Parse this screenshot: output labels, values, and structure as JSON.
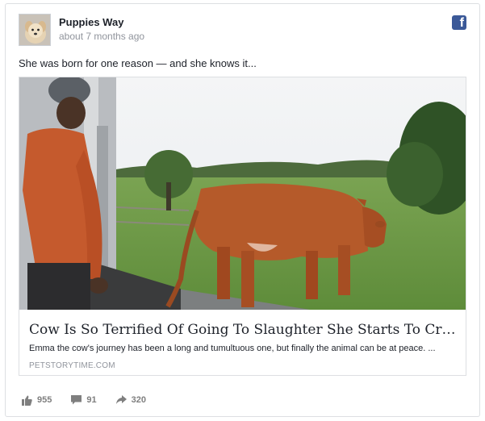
{
  "post": {
    "page_name": "Puppies Way",
    "timestamp": "about 7 months ago",
    "text": "She was born for one reason — and she knows it...",
    "platform_icon": "facebook-icon"
  },
  "link": {
    "title": "Cow Is So Terrified Of Going To Slaughter She Starts To Cry. Now W...",
    "description": "Emma the cow's journey has been a long and tumultuous one, but finally the animal can be at peace. ...",
    "domain": "PETSTORYTIME.COM"
  },
  "stats": {
    "likes": "955",
    "comments": "91",
    "shares": "320"
  },
  "colors": {
    "facebook_blue": "#3b5998",
    "meta_gray": "#90949c",
    "stat_gray": "#7f7f7f"
  }
}
